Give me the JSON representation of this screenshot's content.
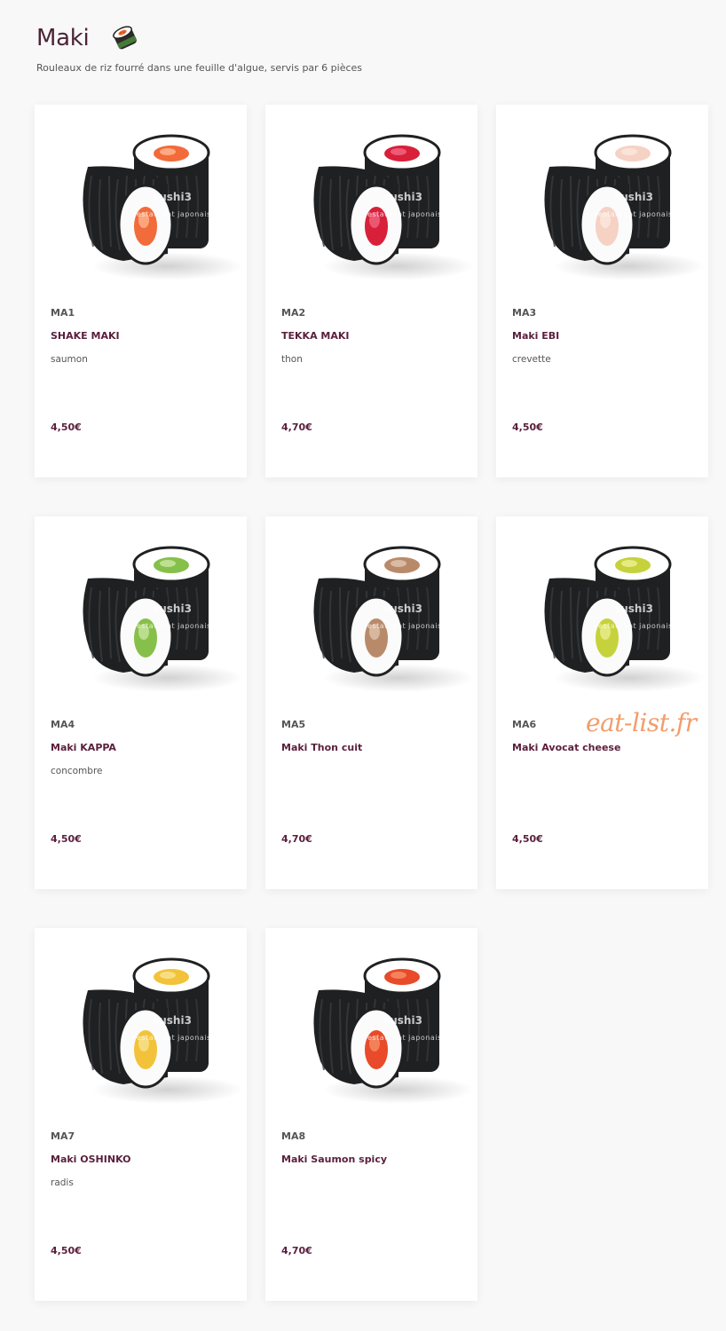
{
  "section": {
    "title": "Maki",
    "icon": "maki-roll-icon",
    "subtitle": "Rouleaux de riz fourré dans une feuille d'algue, servis par 6 pièces"
  },
  "watermark": {
    "brand": "sushi3",
    "tagline": "restaurant japonais",
    "site": "eat-list.fr"
  },
  "colors": {
    "accent": "#5a1f3c",
    "title": "#4d2437",
    "background": "#f8f8f8",
    "site_watermark": "#f08c50"
  },
  "items": [
    {
      "code": "MA1",
      "name": "SHAKE MAKI",
      "description": "saumon",
      "price": "4,50€",
      "filling_color": "#f26b3a",
      "filling_light": "#ffb08a"
    },
    {
      "code": "MA2",
      "name": "TEKKA MAKI",
      "description": "thon",
      "price": "4,70€",
      "filling_color": "#d8203a",
      "filling_light": "#f0607a"
    },
    {
      "code": "MA3",
      "name": "Maki EBI",
      "description": "crevette",
      "price": "4,50€",
      "filling_color": "#f5d2c4",
      "filling_light": "#fbe6dc"
    },
    {
      "code": "MA4",
      "name": "Maki KAPPA",
      "description": "concombre",
      "price": "4,50€",
      "filling_color": "#86c04a",
      "filling_light": "#c4e39a"
    },
    {
      "code": "MA5",
      "name": "Maki Thon cuit",
      "description": "",
      "price": "4,70€",
      "filling_color": "#b98a6a",
      "filling_light": "#dcc0a8"
    },
    {
      "code": "MA6",
      "name": "Maki Avocat cheese",
      "description": "",
      "price": "4,50€",
      "filling_color": "#c6d23c",
      "filling_light": "#e8ec8a"
    },
    {
      "code": "MA7",
      "name": "Maki OSHINKO",
      "description": "radis",
      "price": "4,50€",
      "filling_color": "#f2c33a",
      "filling_light": "#f8e08a"
    },
    {
      "code": "MA8",
      "name": "Maki Saumon spicy",
      "description": "",
      "price": "4,70€",
      "filling_color": "#e84a2a",
      "filling_light": "#f58a60"
    }
  ]
}
